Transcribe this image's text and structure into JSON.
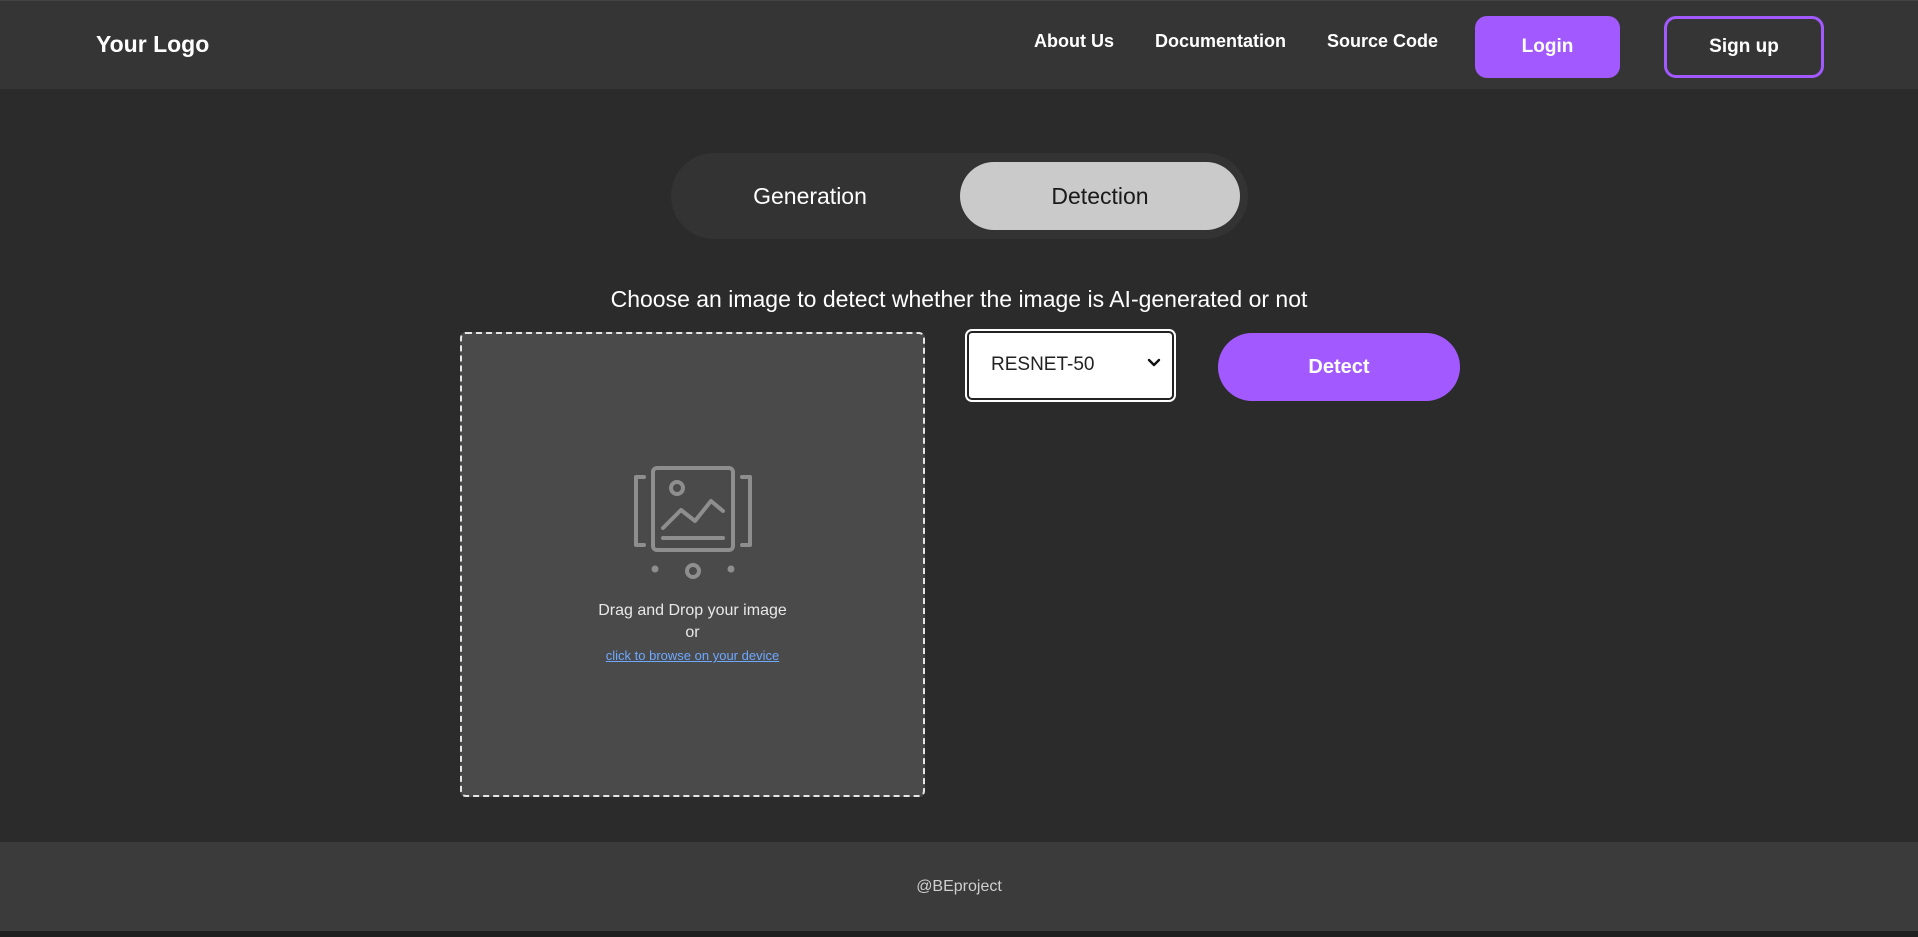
{
  "header": {
    "logo": "Your Logo",
    "nav": {
      "about": "About Us",
      "documentation": "Documentation",
      "source": "Source Code"
    },
    "login_label": "Login",
    "signup_label": "Sign up"
  },
  "mode_toggle": {
    "tabs": [
      "Generation",
      "Detection"
    ],
    "active": "Detection"
  },
  "main": {
    "instruction": "Choose an image to detect whether the image is AI-generated or not",
    "dropzone": {
      "line1": "Drag and Drop your image",
      "line2": "or",
      "browse_link": "click to browse on your device",
      "icon": "image-upload-icon"
    },
    "model_select": {
      "selected": "RESNET-50"
    },
    "detect_label": "Detect"
  },
  "footer": {
    "text": "@BEproject"
  },
  "colors": {
    "accent": "#a259ff",
    "background": "#2b2b2b",
    "header_bg": "#353535",
    "dropzone_bg": "#4a4a4a",
    "link": "#6ea8ff"
  }
}
